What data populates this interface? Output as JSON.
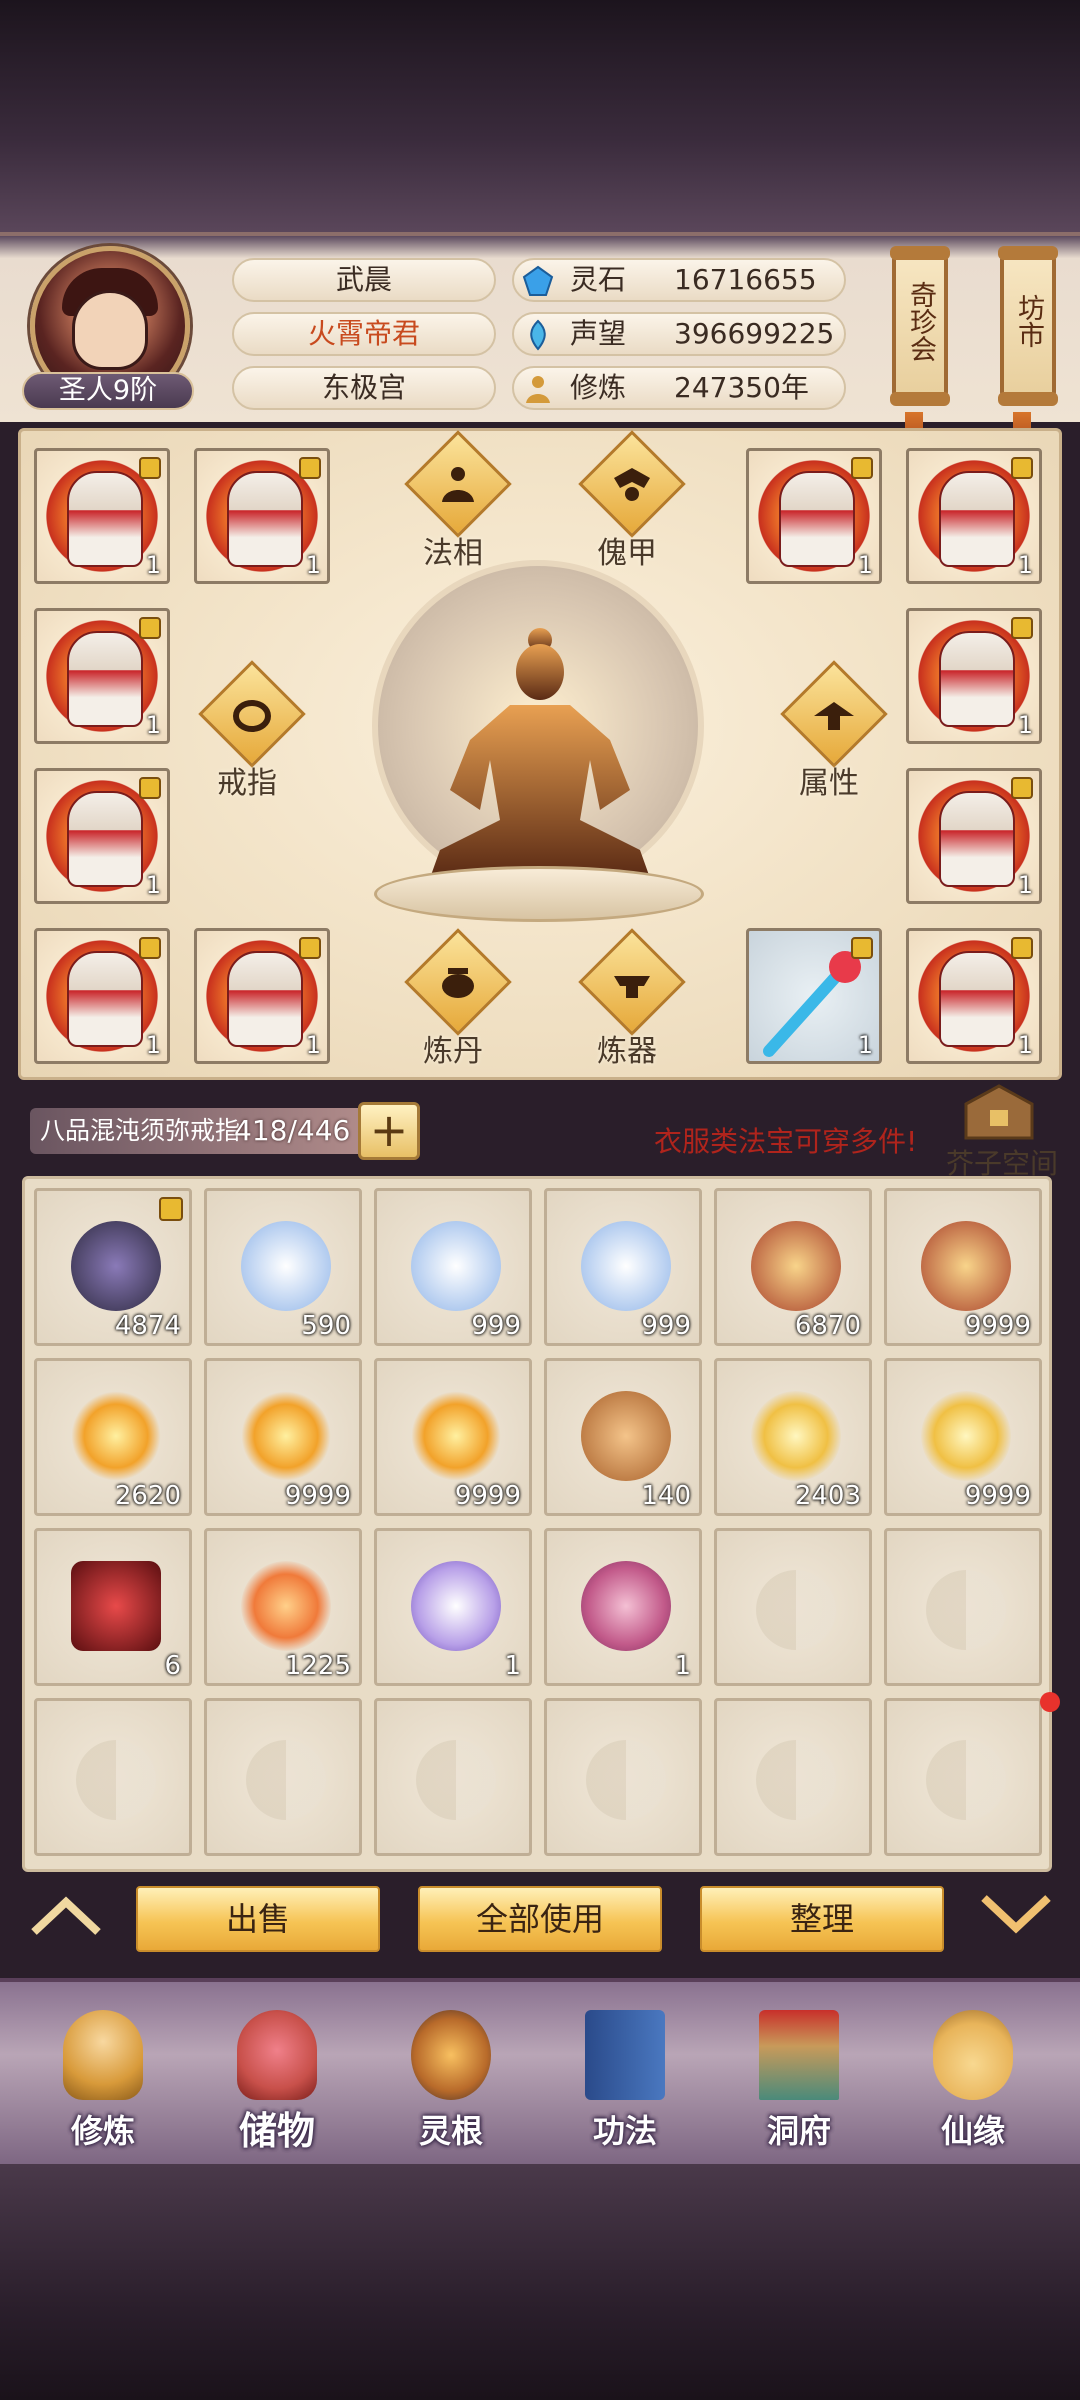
{
  "player": {
    "rank": "圣人9阶",
    "name": "武晨",
    "title": "火霄帝君",
    "faction": "东极宫"
  },
  "resources": [
    {
      "label": "灵石",
      "value": "16716655",
      "icon": "spirit-stone-icon"
    },
    {
      "label": "声望",
      "value": "396699225",
      "icon": "reputation-icon"
    },
    {
      "label": "修炼",
      "value": "247350年",
      "icon": "cultivation-icon"
    }
  ],
  "shortcuts": {
    "treasure_fair": "奇珍会",
    "market": "坊市"
  },
  "equipment": {
    "slot_count": "1",
    "buttons": {
      "fa_xiang": "法相",
      "kui_jia": "傀甲",
      "ring": "戒指",
      "attributes": "属性",
      "alchemy": "炼丹",
      "forging": "炼器"
    }
  },
  "bag": {
    "name": "八品混沌须弥戒指",
    "capacity": "418/446",
    "add_label": "+",
    "hint": "衣服类法宝可穿多件!",
    "space_label": "芥子空间",
    "items": [
      {
        "count": "4874",
        "locked": true,
        "color": "#4a4860"
      },
      {
        "count": "590",
        "color": "#8fb4e8"
      },
      {
        "count": "999",
        "color": "#8fb4e8"
      },
      {
        "count": "999",
        "color": "#8fb4e8"
      },
      {
        "count": "6870",
        "color": "#e6a458"
      },
      {
        "count": "9999",
        "color": "#e6a458"
      },
      {
        "count": "2620",
        "color": "#f2a22a"
      },
      {
        "count": "9999",
        "color": "#f2a22a"
      },
      {
        "count": "9999",
        "color": "#f2a22a"
      },
      {
        "count": "140",
        "color": "#d08a4a"
      },
      {
        "count": "2403",
        "color": "#f0c044"
      },
      {
        "count": "9999",
        "color": "#f0c044"
      },
      {
        "count": "6",
        "color": "#a81e22"
      },
      {
        "count": "1225",
        "color": "#f07a3a"
      },
      {
        "count": "1",
        "color": "#b8a0e8"
      },
      {
        "count": "1",
        "color": "#c25a8a"
      }
    ]
  },
  "actions": {
    "sell": "出售",
    "use_all": "全部使用",
    "sort": "整理"
  },
  "nav": [
    {
      "label": "修炼",
      "color": "#d89a3a"
    },
    {
      "label": "储物",
      "color": "#c8504a"
    },
    {
      "label": "灵根",
      "color": "#b86a2a"
    },
    {
      "label": "功法",
      "color": "#4a78c0"
    },
    {
      "label": "洞府",
      "color": "#c89a5a"
    },
    {
      "label": "仙缘",
      "color": "#e8b45a"
    }
  ]
}
